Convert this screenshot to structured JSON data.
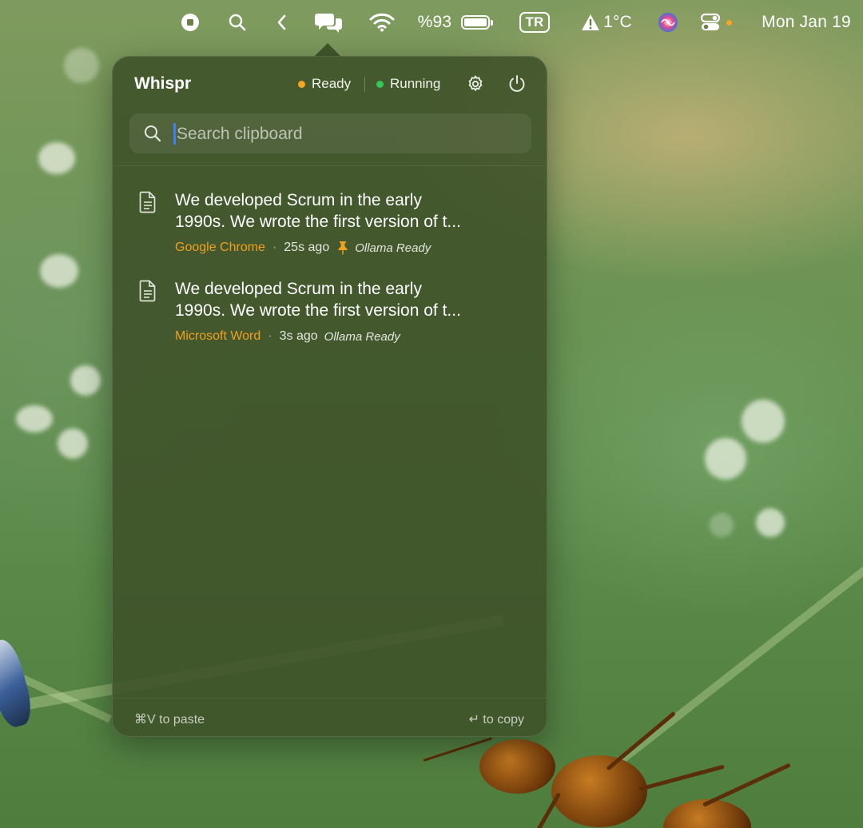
{
  "menubar": {
    "battery_percent": "%93",
    "keyboard_layout": "TR",
    "weather": "1°C",
    "clock": "Mon Jan 19",
    "icons": [
      "stop-circle-icon",
      "search-icon",
      "chevron-left-icon",
      "chat-bubbles-icon",
      "wifi-icon",
      "battery-icon",
      "warning-icon",
      "siri-icon",
      "control-center-icon"
    ]
  },
  "popover": {
    "title": "Whispr",
    "status_ready": "Ready",
    "status_running": "Running",
    "search_placeholder": "Search clipboard",
    "items": [
      {
        "line1": "We developed Scrum in the early",
        "line2": "1990s. We wrote the first version of t...",
        "app": "Google Chrome",
        "separator": "·",
        "time": "25s ago",
        "pinned": true,
        "model_status": "Ollama Ready"
      },
      {
        "line1": "We developed Scrum in the early",
        "line2": "1990s. We wrote the first version of t...",
        "app": "Microsoft Word",
        "separator": "·",
        "time": "3s ago",
        "pinned": false,
        "model_status": "Ollama Ready"
      }
    ],
    "footer_paste": "⌘V to paste",
    "footer_copy": "↵ to copy"
  },
  "colors": {
    "accent_orange": "#f0a020",
    "running_green": "#34c759",
    "ready_orange": "#f5a623",
    "caret_blue": "#3b82f6"
  }
}
